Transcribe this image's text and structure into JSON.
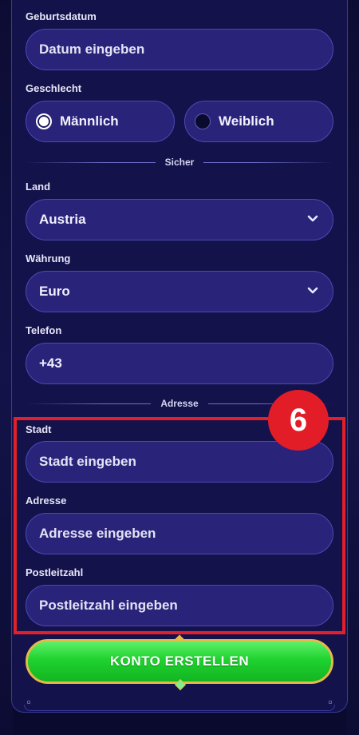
{
  "form": {
    "birthdate": {
      "label": "Geburtsdatum",
      "placeholder": "Datum eingeben"
    },
    "gender": {
      "label": "Geschlecht",
      "options": [
        {
          "label": "Männlich",
          "selected": true
        },
        {
          "label": "Weiblich",
          "selected": false
        }
      ]
    },
    "section_secure": "Sicher",
    "country": {
      "label": "Land",
      "value": "Austria",
      "icon": "chevron-down-icon"
    },
    "currency": {
      "label": "Währung",
      "value": "Euro",
      "icon": "chevron-down-icon"
    },
    "phone": {
      "label": "Telefon",
      "value": "+43"
    },
    "section_address": "Adresse",
    "city": {
      "label": "Stadt",
      "placeholder": "Stadt eingeben"
    },
    "address": {
      "label": "Adresse",
      "placeholder": "Adresse eingeben"
    },
    "postal_code": {
      "label": "Postleitzahl",
      "placeholder": "Postleitzahl eingeben"
    },
    "submit_label": "KONTO ERSTELLEN"
  },
  "annotation": {
    "step_number": "6",
    "color": "#e31d28"
  },
  "colors": {
    "background": "#14124a",
    "field": "#2a237a",
    "field_border": "#4a4ab6",
    "cta_green": "#1fd22f",
    "cta_border": "#e5b94a"
  }
}
